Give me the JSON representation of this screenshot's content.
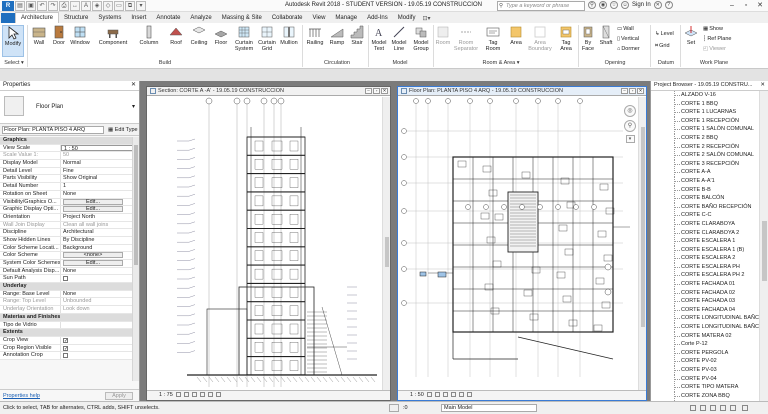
{
  "title_bar": {
    "title": "Autodesk Revit 2018 -  STUDENT VERSION  -   19.05.19 CONSTRUCCION",
    "search_placeholder": "Type a keyword or phrase",
    "sign_in": "Sign In",
    "app_button": "R"
  },
  "tabs": [
    "Architecture",
    "Structure",
    "Systems",
    "Insert",
    "Annotate",
    "Analyze",
    "Massing & Site",
    "Collaborate",
    "View",
    "Manage",
    "Add-Ins",
    "Modify"
  ],
  "file_tab": "",
  "ribbon": {
    "modify": "Modify",
    "select": "Select ▾",
    "build": [
      "Wall",
      "Door",
      "Window",
      "Component",
      "Column",
      "Roof",
      "Ceiling",
      "Floor",
      "Curtain System",
      "Curtain Grid",
      "Mullion"
    ],
    "circulation": [
      "Railing",
      "Ramp",
      "Stair"
    ],
    "model": [
      "Model Text",
      "Model Line",
      "Model Group"
    ],
    "room_area": [
      "Room",
      "Room Separator",
      "Tag Room",
      "Area",
      "Area Boundary",
      "Tag Area"
    ],
    "opening_big": [
      "By Face",
      "Shaft"
    ],
    "opening_small": [
      "Wall",
      "Vertical",
      "Dormer"
    ],
    "datum_small": [
      "Level",
      "Grid"
    ],
    "workplane_big": "Set",
    "workplane_small": [
      "Show",
      "Ref  Plane",
      "Viewer"
    ],
    "groups": {
      "select": "Select ▾",
      "build": "Build",
      "circulation": "Circulation",
      "model": "Model",
      "room_area": "Room & Area ▾",
      "opening": "Opening",
      "datum": "Datum",
      "work_plane": "Work Plane"
    }
  },
  "properties": {
    "header": "Properties",
    "type_name": "Floor Plan",
    "instance_selector": "Floor Plan: PLANTA PISO 4 ARQ",
    "edit_type": "Edit Type",
    "rows": [
      {
        "k": "Graphics",
        "sec": true
      },
      {
        "k": "View Scale",
        "v": "1 : 50",
        "box": true
      },
      {
        "k": "Scale Value   1:",
        "v": "50",
        "dim": true
      },
      {
        "k": "Display Model",
        "v": "Normal"
      },
      {
        "k": "Detail Level",
        "v": "Fine"
      },
      {
        "k": "Parts Visibility",
        "v": "Show Original"
      },
      {
        "k": "Detail Number",
        "v": "1"
      },
      {
        "k": "Rotation on Sheet",
        "v": "None"
      },
      {
        "k": "Visibility/Graphics O...",
        "v": "Edit...",
        "btn": true
      },
      {
        "k": "Graphic Display Opti...",
        "v": "Edit...",
        "btn": true
      },
      {
        "k": "Orientation",
        "v": "Project North"
      },
      {
        "k": "Wall Join Display",
        "v": "Clean all wall joins",
        "dim": true
      },
      {
        "k": "Discipline",
        "v": "Architectural"
      },
      {
        "k": "Show Hidden Lines",
        "v": "By Discipline"
      },
      {
        "k": "Color Scheme Locati...",
        "v": "Background"
      },
      {
        "k": "Color Scheme",
        "v": "<none>",
        "btn": true
      },
      {
        "k": "System Color Schemes",
        "v": "Edit...",
        "btn": true
      },
      {
        "k": "Default Analysis Disp...",
        "v": "None"
      },
      {
        "k": "Sun Path",
        "v": "",
        "check": false
      },
      {
        "k": "Underlay",
        "sec": true
      },
      {
        "k": "Range: Base Level",
        "v": "None"
      },
      {
        "k": "Range: Top Level",
        "v": "Unbounded",
        "dim": true
      },
      {
        "k": "Underlay Orientation",
        "v": "Look down",
        "dim": true
      },
      {
        "k": "Materias and Finishes",
        "sec": true
      },
      {
        "k": "Tipo de Vidrio",
        "v": ""
      },
      {
        "k": "Extents",
        "sec": true
      },
      {
        "k": "Crop View",
        "v": "",
        "check": true
      },
      {
        "k": "Crop Region Visible",
        "v": "",
        "check": true
      },
      {
        "k": "Annotation Crop",
        "v": "",
        "check": false
      }
    ],
    "help_link": "Properties help",
    "apply": "Apply"
  },
  "views": {
    "section_title": "Section: CORTE A -A' - 19.05.19 CONSTRUCCION",
    "section_scale": "1 : 75",
    "plan_title": "Floor Plan: PLANTA PISO 4 ARQ - 19.05.19 CONSTRUCCION",
    "plan_scale": "1 : 50"
  },
  "project_browser": {
    "header": "Project Browser - 19.05.19 CONSTRU...",
    "items": [
      "ALZADO V-16",
      "CORTE 1 BBQ",
      "CORTE 1 LUCARNAS",
      "CORTE 1 RECEPCIÓN",
      "CORTE 1 SALÓN COMUNAL",
      "CORTE 2 BBQ",
      "CORTE 2 RECEPCIÓN",
      "CORTE 2 SALÓN COMUNAL",
      "CORTE 3 RECEPCIÓN",
      "CORTE A-A",
      "CORTE A-A'1",
      "CORTE B-B",
      "CORTE BALCÓN",
      "CORTE BAÑO RECEPCIÓN",
      "CORTE C-C",
      "CORTE CLARABOYA",
      "CORTE CLARABOYA 2",
      "CORTE ESCALERA 1",
      "CORTE ESCALERA 1 (B)",
      "CORTE ESCALERA 2",
      "CORTE ESCALERA PH",
      "CORTE ESCALERA PH 2",
      "CORTE FACHADA 01",
      "CORTE FACHADA 02",
      "CORTE FACHADA 03",
      "CORTE FACHADA 04",
      "CORTE LONGITUDINAL BAÑC",
      "CORTE LONGITUDINAL BAÑC",
      "CORTE MATERA 02",
      "Corte P-12",
      "CORTE PERGOLA",
      "CORTE PV-02",
      "CORTE PV-03",
      "CORTE PV-04",
      "CORTE TIPO MATERA",
      "CORTE ZONA BBQ"
    ]
  },
  "status": {
    "text": "Click to select, TAB for alternates, CTRL adds, SHIFT unselects.",
    "zero": ":0",
    "model": "Main Model"
  }
}
